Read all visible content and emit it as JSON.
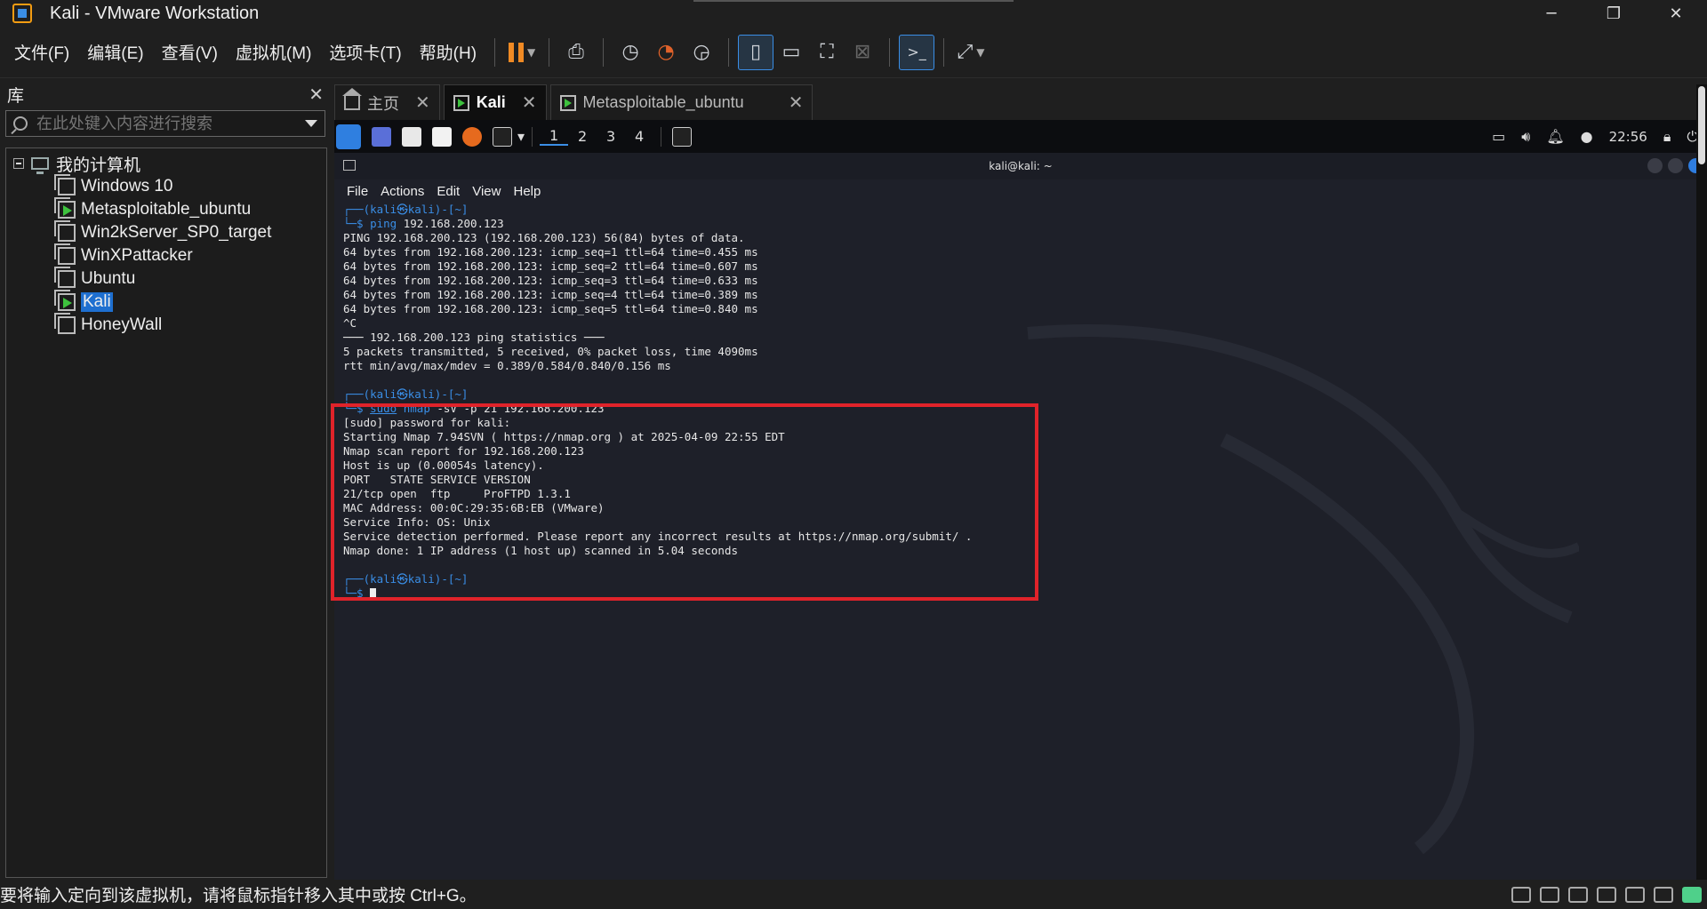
{
  "window": {
    "title": "Kali - VMware Workstation",
    "controls": [
      "minimize-icon",
      "maximize-icon",
      "close-icon"
    ]
  },
  "menu": {
    "items": [
      "文件(F)",
      "编辑(E)",
      "查看(V)",
      "虚拟机(M)",
      "选项卡(T)",
      "帮助(H)"
    ]
  },
  "toolbar": {
    "accent": "#f08a24",
    "icons": [
      "pause-icon",
      "send-keys-icon",
      "snapshot-icon",
      "revert-snapshot-icon",
      "snapshot-manager-icon",
      "library-view-icon",
      "thumbnail-bar-icon",
      "fullscreen-icon",
      "unity-icon",
      "console-view-icon",
      "stretch-icon"
    ]
  },
  "library": {
    "title": "库",
    "search_placeholder": "在此处键入内容进行搜索",
    "root": "我的计算机",
    "vms": [
      {
        "name": "Windows 10",
        "running": false,
        "selected": false
      },
      {
        "name": "Metasploitable_ubuntu",
        "running": true,
        "selected": false
      },
      {
        "name": "Win2kServer_SP0_target",
        "running": false,
        "selected": false
      },
      {
        "name": "WinXPattacker",
        "running": false,
        "selected": false
      },
      {
        "name": "Ubuntu",
        "running": false,
        "selected": false
      },
      {
        "name": "Kali",
        "running": true,
        "selected": true
      },
      {
        "name": "HoneyWall",
        "running": false,
        "selected": false
      }
    ]
  },
  "tabs": [
    {
      "label": "主页",
      "active": false
    },
    {
      "label": "Kali",
      "active": true
    },
    {
      "label": "Metasploitable_ubuntu",
      "active": false
    }
  ],
  "kali_panel": {
    "workspaces": [
      "1",
      "2",
      "3",
      "4"
    ],
    "clock": "22:56"
  },
  "terminal": {
    "title": "kali@kali: ~",
    "menu": [
      "File",
      "Actions",
      "Edit",
      "View",
      "Help"
    ],
    "prompt_top": "┌──(kali㉿kali)-[~]",
    "prompt_bottom": "└─$ ",
    "cmd1": "ping",
    "cmd1_args": " 192.168.200.123",
    "ping_output": [
      "PING 192.168.200.123 (192.168.200.123) 56(84) bytes of data.",
      "64 bytes from 192.168.200.123: icmp_seq=1 ttl=64 time=0.455 ms",
      "64 bytes from 192.168.200.123: icmp_seq=2 ttl=64 time=0.607 ms",
      "64 bytes from 192.168.200.123: icmp_seq=3 ttl=64 time=0.633 ms",
      "64 bytes from 192.168.200.123: icmp_seq=4 ttl=64 time=0.389 ms",
      "64 bytes from 192.168.200.123: icmp_seq=5 ttl=64 time=0.840 ms",
      "^C",
      "─── 192.168.200.123 ping statistics ───",
      "5 packets transmitted, 5 received, 0% packet loss, time 4090ms",
      "rtt min/avg/max/mdev = 0.389/0.584/0.840/0.156 ms"
    ],
    "cmd2_sudo": "sudo",
    "cmd2": "nmap",
    "cmd2_args": " -sV -p 21 192.168.200.123",
    "nmap_output": [
      "[sudo] password for kali:",
      "Starting Nmap 7.94SVN ( https://nmap.org ) at 2025-04-09 22:55 EDT",
      "Nmap scan report for 192.168.200.123",
      "Host is up (0.00054s latency).",
      "",
      "PORT   STATE SERVICE VERSION",
      "21/tcp open  ftp     ProFTPD 1.3.1",
      "MAC Address: 00:0C:29:35:6B:EB (VMware)",
      "Service Info: OS: Unix",
      "",
      "Service detection performed. Please report any incorrect results at https://nmap.org/submit/ .",
      "Nmap done: 1 IP address (1 host up) scanned in 5.04 seconds"
    ]
  },
  "annotation": {
    "color": "#e0232a"
  },
  "statusbar": {
    "text": "要将输入定向到该虚拟机，请将鼠标指针移入其中或按 Ctrl+G。"
  }
}
